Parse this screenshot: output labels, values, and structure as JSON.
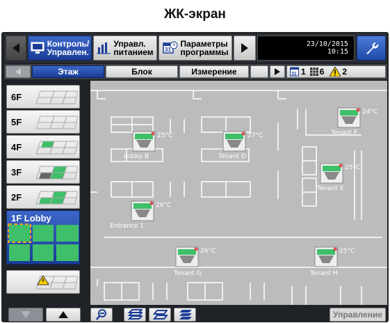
{
  "caption": "ЖК-экран",
  "header": {
    "tabs": [
      {
        "line1": "Контроль/",
        "line2": "Управлен.",
        "icon": "monitor-icon",
        "active": true
      },
      {
        "line1": "Управл.",
        "line2": "питанием",
        "icon": "bar-chart-icon",
        "active": false
      },
      {
        "line1": "Параметры",
        "line2": "программы",
        "icon": "calendar-clock-icon",
        "active": false
      }
    ],
    "date": "23/10/2015",
    "time": "10:15"
  },
  "subtabs": {
    "floor": "Этаж",
    "block": "Блок",
    "measure": "Измерение"
  },
  "status": {
    "schedule_count": "1",
    "grid_count": "6",
    "warning_count": "2"
  },
  "floors": [
    {
      "label": "6F"
    },
    {
      "label": "5F"
    },
    {
      "label": "4F"
    },
    {
      "label": "3F"
    },
    {
      "label": "2F"
    },
    {
      "label": "1F Lobby"
    }
  ],
  "units": [
    {
      "temp": "25°C"
    },
    {
      "temp": "27°C"
    },
    {
      "temp": "24°C"
    },
    {
      "temp": "25°C"
    },
    {
      "temp": "26°C"
    },
    {
      "temp": "26°C"
    },
    {
      "temp": "25°C"
    }
  ],
  "zones": {
    "lobby_b": "Lobby B",
    "tenant_d": "Tenant D",
    "tenant_f": "Tenant F",
    "tenant_e": "Tenant E",
    "entrance_1": "Entrance 1",
    "tenant_g": "Tenant G",
    "tenant_h": "Tenant H"
  },
  "bottom": {
    "control_label": "Управление"
  },
  "colors": {
    "active_blue": "#1a3d97",
    "unit_green": "#3fbf6a",
    "selection_orange": "#f0a020",
    "warning_yellow": "#ffd400"
  }
}
